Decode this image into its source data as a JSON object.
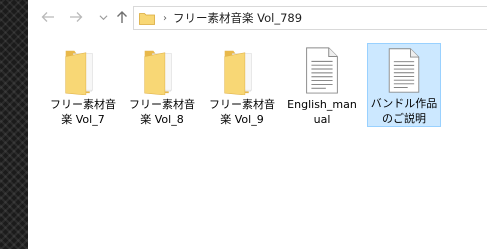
{
  "navigation": {
    "back": "back-arrow",
    "forward": "forward-arrow",
    "recent": "chevron-down",
    "up": "up-arrow"
  },
  "address_bar": {
    "path": "フリー素材音楽 Vol_789",
    "separator": "›"
  },
  "items": [
    {
      "label": "フリー素材音楽 Vol_7",
      "type": "folder"
    },
    {
      "label": "フリー素材音楽 Vol_8",
      "type": "folder"
    },
    {
      "label": "フリー素材音楽 Vol_9",
      "type": "folder"
    },
    {
      "label": "English_manual",
      "type": "document"
    },
    {
      "label": "バンドル作品のご説明",
      "type": "document",
      "selected": true
    }
  ],
  "colors": {
    "folder": "#f8d775",
    "folder_dark": "#e8b84a",
    "selection": "#cce8ff",
    "selection_border": "#99d1ff"
  }
}
